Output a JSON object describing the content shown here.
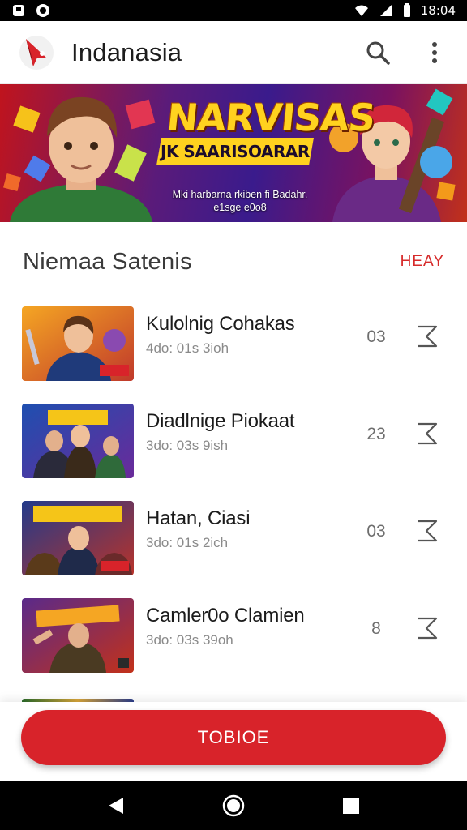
{
  "status_bar": {
    "time": "18:04",
    "icons": [
      "notification-icon",
      "circle-app-icon",
      "wifi-icon",
      "signal-icon",
      "battery-icon"
    ]
  },
  "app_bar": {
    "title": "Indanasia",
    "icons": [
      "app-logo",
      "search-icon",
      "more-vert-icon"
    ]
  },
  "banner": {
    "title": "NARVISAS",
    "ribbon_text": "JK SAARISOARAR",
    "caption_line1": "Mki harbarna rkiben fi Badahr.",
    "caption_line2": "e1sge e0o8"
  },
  "section": {
    "title": "Niemaa Satenis",
    "action_label": "HEAY"
  },
  "items": [
    {
      "title": "Kulolnig Cohakas",
      "meta": "4do: 01s 3ioh",
      "count": "03",
      "thumb_icon": "game-thumb-hero"
    },
    {
      "title": "Diadlnige Piokaat",
      "meta": "3do: 03s 9ish",
      "count": "23",
      "thumb_icon": "game-thumb-warriors"
    },
    {
      "title": "Hatan, Ciasi",
      "meta": "3do: 01s 2ich",
      "count": "03",
      "thumb_icon": "game-thumb-heroes"
    },
    {
      "title": "Camler0o Clamien",
      "meta": "3do: 03s 39oh",
      "count": "8",
      "thumb_icon": "game-thumb-champion"
    }
  ],
  "cta": {
    "label": "TOBIOE"
  },
  "nav_bar": {
    "icons": [
      "back-icon",
      "home-icon",
      "recents-icon"
    ]
  },
  "colors": {
    "accent": "#d8232a",
    "action_text": "#d62a2a",
    "banner_title": "#ffd21f"
  }
}
